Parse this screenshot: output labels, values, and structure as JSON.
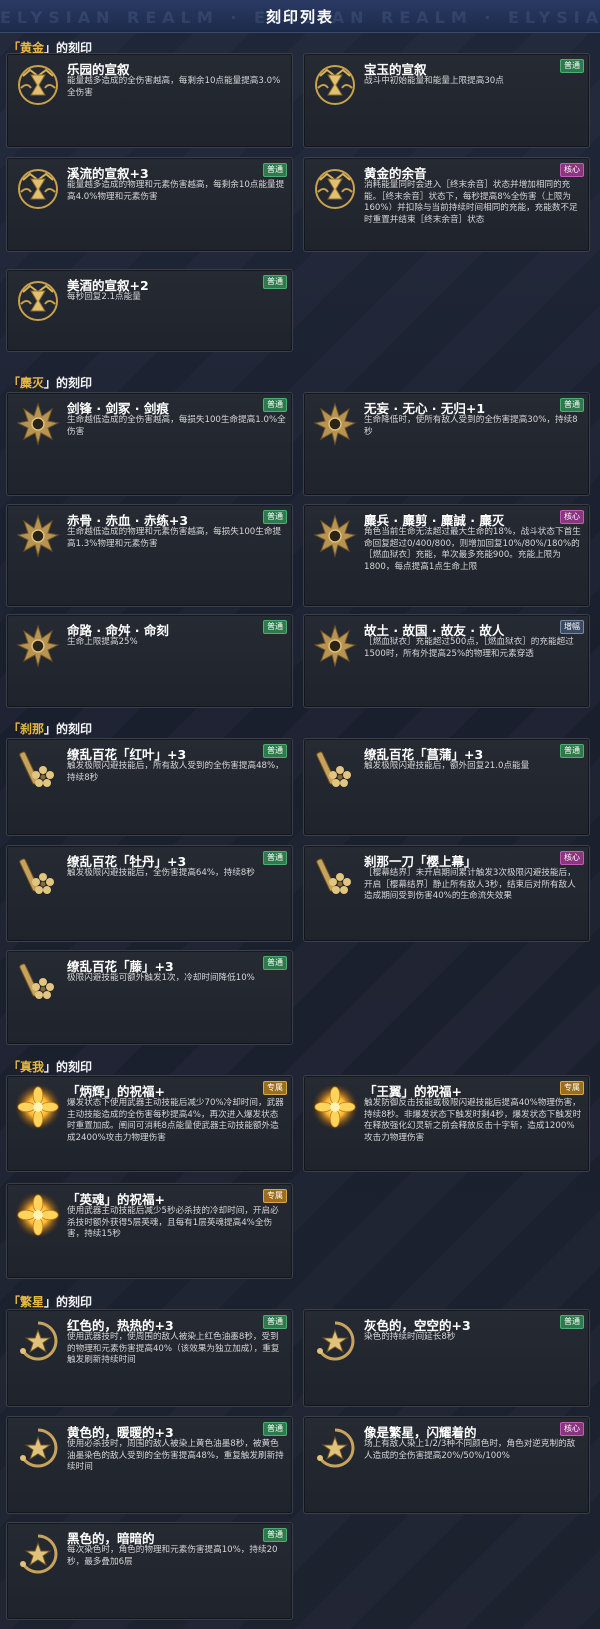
{
  "header": {
    "title": "刻印列表",
    "watermark": "ELYSIAN REALM · ELYSIAN REALM · ELYSIAN REALM · ELYS"
  },
  "colors": {
    "gold": "#e6b940",
    "tag_common": "#2e7a4c",
    "tag_core": "#8a3580",
    "tag_exclusive": "#9b6e1d",
    "tag_enhance": "#3a4a62"
  },
  "sections": {
    "gold": {
      "label_open": "「",
      "label_name": "黄金",
      "label_close": "」的刻印"
    },
    "dest": {
      "label_open": "「",
      "label_name": "麋灭",
      "label_close": "」的刻印"
    },
    "kali": {
      "label_open": "「",
      "label_name": "刹那",
      "label_close": "」的刻印"
    },
    "self": {
      "label_open": "「",
      "label_name": "真我",
      "label_close": "」的刻印"
    },
    "star": {
      "label_open": "「",
      "label_name": "繁星",
      "label_close": "」的刻印"
    }
  },
  "cards": [
    {
      "name": "乐园的宣叙",
      "tag": "",
      "icon": "gold-hourglass-icon",
      "desc": "能量越多造成的全伤害越高，每剩余10点能量提高3.0%全伤害"
    },
    {
      "name": "宝玉的宣叙",
      "tag": "普通",
      "icon": "gold-hourglass-icon",
      "desc": "战斗中初始能量和能量上限提高30点"
    },
    {
      "name": "溪流的宣叙+3",
      "tag": "普通",
      "icon": "gold-hourglass-icon",
      "desc": "能量越多造成的物理和元素伤害越高，每剩余10点能量提高4.0%物理和元素伤害"
    },
    {
      "name": "黄金的余音",
      "tag": "核心",
      "icon": "gold-hourglass-icon",
      "desc": "消耗能量同时会进入［终末余音］状态并增加相同的充能。［终末余音］状态下，每秒提高8%全伤害（上限为160%）并扣除与当前持续时间相同的充能，充能数不足时重置并结束［终末余音］状态"
    },
    {
      "name": "美酒的宣叙+2",
      "tag": "普通",
      "icon": "gold-hourglass-icon",
      "desc": "每秒回复2.1点能量"
    },
    {
      "name": "剑锋 · 剑冢 · 剑痕",
      "tag": "普通",
      "icon": "destruction-crown-icon",
      "desc": "生命越低造成的全伤害越高，每损失100生命提高1.0%全伤害"
    },
    {
      "name": "无妄 · 无心 · 无归+1",
      "tag": "普通",
      "icon": "destruction-crown-icon",
      "desc": "生命降低时，使所有敌人受到的全伤害提高30%，持续8秒"
    },
    {
      "name": "赤骨 · 赤血 · 赤练+3",
      "tag": "普通",
      "icon": "destruction-crown-icon",
      "desc": "生命越低造成的物理和元素伤害越高，每损失100生命提高1.3%物理和元素伤害"
    },
    {
      "name": "麋兵 · 麋剪 · 麋誠 · 麋灭",
      "tag": "核心",
      "icon": "destruction-crown-icon",
      "desc": "角色当前生命无法超过最大生命的18%，战斗状态下首生命回复超过0/400/800，则增加回复10%/80%/180%的［燃血狱衣］充能，单次最多充能900。充能上限为1800，每点提高1点生命上限"
    },
    {
      "name": "命路 · 命舛 · 命刻",
      "tag": "普通",
      "icon": "destruction-crown-icon",
      "desc": "生命上限提高25%"
    },
    {
      "name": "故土 · 故国 · 故友 · 故人",
      "tag": "增幅",
      "icon": "destruction-crown-icon",
      "desc": "［燃血狱衣］充能超过500点，［燃血狱衣］的充能超过1500时，所有外提高25%的物理和元素穿透"
    },
    {
      "name": "缭乱百花「红叶」+3",
      "tag": "普通",
      "icon": "blossom-blade-icon",
      "desc": "触发极限闪避技能后，所有敌人受到的全伤害提高48%，持续8秒"
    },
    {
      "name": "缭乱百花「菖蒲」+3",
      "tag": "普通",
      "icon": "blossom-blade-icon",
      "desc": "触发极限闪避技能后，额外回复21.0点能量"
    },
    {
      "name": "缭乱百花「牡丹」+3",
      "tag": "普通",
      "icon": "blossom-blade-icon",
      "desc": "触发极限闪避技能后，全伤害提高64%，持续8秒"
    },
    {
      "name": "刹那一刀「樱上幕」",
      "tag": "核心",
      "icon": "blossom-blade-icon",
      "desc": "［樱幕结界］未开启期间累计触发3次极限闪避技能后，开启［樱幕结界］静止所有敌人3秒，结束后对所有敌人造成期间受到伤害40%的生命流失效果"
    },
    {
      "name": "缭乱百花「藤」+3",
      "tag": "普通",
      "icon": "blossom-blade-icon",
      "desc": "极限闪避技能可额外触发1次，冷却时间降低10%"
    },
    {
      "name": "「炳辉」的祝福+",
      "tag": "专属",
      "icon": "radiant-flower-icon",
      "desc": "爆发状态下使用武器主动技能后减少70%冷却时间，武器主动技能造成的全伤害每秒提高4%，再次进入爆发状态时重置加成。阐间可消耗8点能量使武器主动技能额外造成2400%攻击力物理伤害"
    },
    {
      "name": "「王翼」的祝福+",
      "tag": "专属",
      "icon": "radiant-flower-icon",
      "desc": "触发防御反击技能或极限闪避技能后提高40%物理伤害，持续8秒。非爆发状态下触发时剩4秒，爆发状态下触发时在释放强化幻灵斩之前会释放反击十字斩，造成1200%攻击力物理伤害"
    },
    {
      "name": "「英魂」的祝福+",
      "tag": "专属",
      "icon": "radiant-flower-icon",
      "desc": "使用武器主动技能后减少5秒必杀技的冷却时间，开启必杀技时额外获得5层英魂，且每有1层英魂提高4%全伤害，持续15秒"
    },
    {
      "name": "红色的，热热的+3",
      "tag": "普通",
      "icon": "star-swirl-icon",
      "desc": "使用武器技时，使周围的敌人被染上红色油墨8秒，受到的物理和元素伤害提高40%（该效果为独立加成），重复触发刷新持续时间"
    },
    {
      "name": "灰色的，空空的+3",
      "tag": "普通",
      "icon": "star-swirl-icon",
      "desc": "染色的持续时间延长8秒"
    },
    {
      "name": "黄色的，暖暖的+3",
      "tag": "普通",
      "icon": "star-swirl-icon",
      "desc": "使用必杀技时，周围的敌人被染上黄色油墨8秒，被黄色油墨染色的敌人受到的全伤害提高48%，重复触发刷新持续时间"
    },
    {
      "name": "像是繁星，闪耀着的",
      "tag": "核心",
      "icon": "star-swirl-icon",
      "desc": "场上有敌人染上1/2/3种不同颜色时，角色对逆克制的敌人造成的全伤害提高20%/50%/100%"
    },
    {
      "name": "黑色的，暗暗的",
      "tag": "普通",
      "icon": "star-swirl-icon",
      "desc": "每次染色时，角色的物理和元素伤害提高10%，持续20秒，最多叠加6层"
    }
  ]
}
